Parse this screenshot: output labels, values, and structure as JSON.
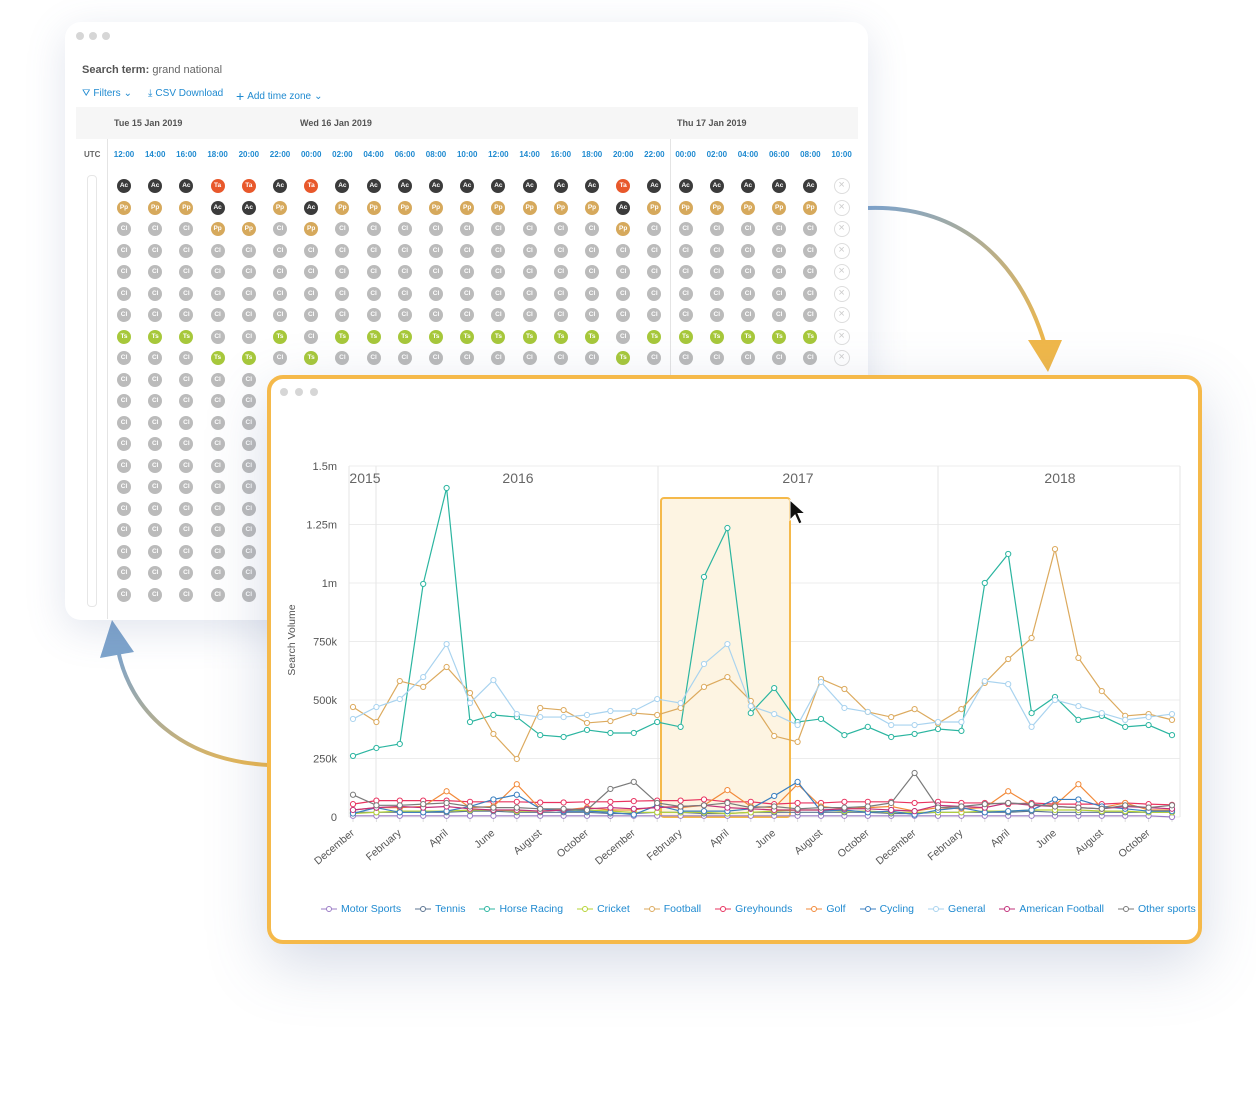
{
  "schedule": {
    "search_term_label": "Search term:",
    "search_term": "grand national",
    "toolbar": {
      "filters": "Filters",
      "csv": "CSV Download",
      "add_tz": "Add time zone"
    },
    "dates": [
      "Tue 15 Jan 2019",
      "Wed 16 Jan 2019",
      "Thu 17 Jan 2019"
    ],
    "timezone": "UTC",
    "times": [
      "12:00",
      "14:00",
      "16:00",
      "18:00",
      "20:00",
      "22:00",
      "00:00",
      "02:00",
      "04:00",
      "06:00",
      "08:00",
      "10:00",
      "12:00",
      "14:00",
      "16:00",
      "18:00",
      "20:00",
      "22:00",
      "00:00",
      "02:00",
      "04:00",
      "06:00",
      "08:00",
      "10:00"
    ],
    "badge_colors": {
      "Ac": "#3b3b3b",
      "Ta": "#e8582b",
      "Pp": "#d6a95c",
      "Cl": "#bbbbbb",
      "Ts": "#a7c83b"
    },
    "rows": [
      [
        "Ac",
        "Ac",
        "Ac",
        "Ta",
        "Ta",
        "Ac",
        "Ta",
        "Ac",
        "Ac",
        "Ac",
        "Ac",
        "Ac",
        "Ac",
        "Ac",
        "Ac",
        "Ac",
        "Ta",
        "Ac",
        "Ac",
        "Ac",
        "Ac",
        "Ac",
        "Ac",
        "X"
      ],
      [
        "Pp",
        "Pp",
        "Pp",
        "Ac",
        "Ac",
        "Pp",
        "Ac",
        "Pp",
        "Pp",
        "Pp",
        "Pp",
        "Pp",
        "Pp",
        "Pp",
        "Pp",
        "Pp",
        "Ac",
        "Pp",
        "Pp",
        "Pp",
        "Pp",
        "Pp",
        "Pp",
        "X"
      ],
      [
        "Cl",
        "Cl",
        "Cl",
        "Pp",
        "Pp",
        "Cl",
        "Pp",
        "Cl",
        "Cl",
        "Cl",
        "Cl",
        "Cl",
        "Cl",
        "Cl",
        "Cl",
        "Cl",
        "Pp",
        "Cl",
        "Cl",
        "Cl",
        "Cl",
        "Cl",
        "Cl",
        "X"
      ],
      [
        "Cl",
        "Cl",
        "Cl",
        "Cl",
        "Cl",
        "Cl",
        "Cl",
        "Cl",
        "Cl",
        "Cl",
        "Cl",
        "Cl",
        "Cl",
        "Cl",
        "Cl",
        "Cl",
        "Cl",
        "Cl",
        "Cl",
        "Cl",
        "Cl",
        "Cl",
        "Cl",
        "X"
      ],
      [
        "Cl",
        "Cl",
        "Cl",
        "Cl",
        "Cl",
        "Cl",
        "Cl",
        "Cl",
        "Cl",
        "Cl",
        "Cl",
        "Cl",
        "Cl",
        "Cl",
        "Cl",
        "Cl",
        "Cl",
        "Cl",
        "Cl",
        "Cl",
        "Cl",
        "Cl",
        "Cl",
        "X"
      ],
      [
        "Cl",
        "Cl",
        "Cl",
        "Cl",
        "Cl",
        "Cl",
        "Cl",
        "Cl",
        "Cl",
        "Cl",
        "Cl",
        "Cl",
        "Cl",
        "Cl",
        "Cl",
        "Cl",
        "Cl",
        "Cl",
        "Cl",
        "Cl",
        "Cl",
        "Cl",
        "Cl",
        "X"
      ],
      [
        "Cl",
        "Cl",
        "Cl",
        "Cl",
        "Cl",
        "Cl",
        "Cl",
        "Cl",
        "Cl",
        "Cl",
        "Cl",
        "Cl",
        "Cl",
        "Cl",
        "Cl",
        "Cl",
        "Cl",
        "Cl",
        "Cl",
        "Cl",
        "Cl",
        "Cl",
        "Cl",
        "X"
      ],
      [
        "Ts",
        "Ts",
        "Ts",
        "Cl",
        "Cl",
        "Ts",
        "Cl",
        "Ts",
        "Ts",
        "Ts",
        "Ts",
        "Ts",
        "Ts",
        "Ts",
        "Ts",
        "Ts",
        "Cl",
        "Ts",
        "Ts",
        "Ts",
        "Ts",
        "Ts",
        "Ts",
        "X"
      ],
      [
        "Cl",
        "Cl",
        "Cl",
        "Ts",
        "Ts",
        "Cl",
        "Ts",
        "Cl",
        "Cl",
        "Cl",
        "Cl",
        "Cl",
        "Cl",
        "Cl",
        "Cl",
        "Cl",
        "Ts",
        "Cl",
        "Cl",
        "Cl",
        "Cl",
        "Cl",
        "Cl",
        "X"
      ],
      [
        "Cl",
        "Cl",
        "Cl",
        "Cl",
        "Cl"
      ],
      [
        "Cl",
        "Cl",
        "Cl",
        "Cl",
        "Cl"
      ],
      [
        "Cl",
        "Cl",
        "Cl",
        "Cl",
        "Cl"
      ],
      [
        "Cl",
        "Cl",
        "Cl",
        "Cl",
        "Cl"
      ],
      [
        "Cl",
        "Cl",
        "Cl",
        "Cl",
        "Cl"
      ],
      [
        "Cl",
        "Cl",
        "Cl",
        "Cl",
        "Cl"
      ],
      [
        "Cl",
        "Cl",
        "Cl",
        "Cl",
        "Cl"
      ],
      [
        "Cl",
        "Cl",
        "Cl",
        "Cl",
        "Cl"
      ],
      [
        "Cl",
        "Cl",
        "Cl",
        "Cl",
        "Cl"
      ],
      [
        "Cl",
        "Cl",
        "Cl",
        "Cl",
        "Cl"
      ],
      [
        "Cl",
        "Cl",
        "Cl",
        "Cl",
        "Cl"
      ]
    ]
  },
  "chart_data": {
    "type": "line",
    "ylabel": "Search Volume",
    "ylim": [
      0,
      1500000
    ],
    "yticks": [
      "0",
      "250k",
      "500k",
      "750k",
      "1m",
      "1.25m",
      "1.5m"
    ],
    "years": [
      "2015",
      "2016",
      "2017",
      "2018"
    ],
    "x": [
      "December",
      "January",
      "February",
      "March",
      "April",
      "May",
      "June",
      "July",
      "August",
      "September",
      "October",
      "November",
      "December",
      "January",
      "February",
      "March",
      "April",
      "May",
      "June",
      "July",
      "August",
      "September",
      "October",
      "November",
      "December",
      "January",
      "February",
      "March",
      "April",
      "May",
      "June",
      "July",
      "August",
      "September",
      "October",
      "November"
    ],
    "xtick_labels": [
      "December",
      "February",
      "April",
      "June",
      "August",
      "October",
      "December",
      "February",
      "April",
      "June",
      "August",
      "October",
      "December",
      "February",
      "April",
      "June",
      "August",
      "October"
    ],
    "highlight_range": [
      "January",
      "June"
    ],
    "grid": true,
    "legend_position": "bottom",
    "series": [
      {
        "name": "Motor Sports",
        "color": "#9b7cc6",
        "values": [
          5,
          5,
          5,
          5,
          5,
          5,
          5,
          5,
          5,
          5,
          5,
          5,
          5,
          5,
          5,
          5,
          5,
          5,
          5,
          5,
          5,
          5,
          5,
          5,
          5,
          5,
          5,
          5,
          5,
          5,
          5,
          5,
          5,
          5,
          5,
          0
        ]
      },
      {
        "name": "Tennis",
        "color": "#5d7592",
        "values": [
          20,
          20,
          20,
          20,
          20,
          25,
          25,
          20,
          20,
          20,
          20,
          15,
          15,
          20,
          20,
          15,
          15,
          20,
          20,
          20,
          20,
          20,
          20,
          15,
          15,
          20,
          20,
          20,
          20,
          25,
          20,
          20,
          20,
          20,
          20,
          20
        ]
      },
      {
        "name": "Horse Racing",
        "color": "#2bb5a0",
        "values": [
          261,
          295,
          312,
          996,
          1406,
          406,
          436,
          427,
          350,
          342,
          372,
          359,
          359,
          406,
          385,
          1026,
          1235,
          444,
          551,
          406,
          419,
          350,
          385,
          342,
          355,
          376,
          368,
          1000,
          1124,
          444,
          513,
          415,
          432,
          385,
          393,
          350
        ]
      },
      {
        "name": "Cricket",
        "color": "#b6d336",
        "values": [
          15,
          20,
          25,
          25,
          25,
          30,
          30,
          25,
          25,
          30,
          30,
          25,
          20,
          20,
          20,
          20,
          15,
          20,
          25,
          30,
          30,
          25,
          25,
          20,
          20,
          20,
          20,
          25,
          25,
          30,
          30,
          30,
          25,
          25,
          20,
          20
        ]
      },
      {
        "name": "Football",
        "color": "#dcaa5e",
        "values": [
          470,
          406,
          581,
          556,
          641,
          530,
          355,
          248,
          466,
          457,
          402,
          410,
          444,
          436,
          466,
          556,
          598,
          496,
          346,
          321,
          590,
          547,
          449,
          427,
          461,
          400,
          461,
          573,
          675,
          765,
          1145,
          680,
          538,
          432,
          440,
          415
        ]
      },
      {
        "name": "Greyhounds",
        "color": "#e8335f",
        "values": [
          55,
          70,
          70,
          70,
          70,
          65,
          65,
          65,
          62,
          62,
          65,
          65,
          68,
          70,
          70,
          75,
          65,
          65,
          55,
          60,
          60,
          65,
          65,
          65,
          60,
          65,
          60,
          60,
          55,
          60,
          55,
          55,
          55,
          60,
          55,
          52
        ]
      },
      {
        "name": "Golf",
        "color": "#f28a3a",
        "values": [
          30,
          40,
          40,
          45,
          110,
          40,
          45,
          140,
          35,
          30,
          40,
          30,
          30,
          45,
          40,
          50,
          115,
          45,
          40,
          140,
          45,
          35,
          40,
          45,
          25,
          40,
          35,
          40,
          110,
          50,
          50,
          140,
          40,
          60,
          30,
          30
        ]
      },
      {
        "name": "Cycling",
        "color": "#3a7fc0",
        "values": [
          15,
          40,
          20,
          20,
          25,
          45,
          75,
          95,
          35,
          25,
          25,
          20,
          10,
          50,
          25,
          25,
          25,
          35,
          90,
          150,
          25,
          30,
          20,
          25,
          10,
          30,
          40,
          20,
          25,
          30,
          75,
          75,
          45,
          35,
          25,
          25
        ]
      },
      {
        "name": "General",
        "color": "#a9d3ef",
        "values": [
          419,
          470,
          504,
          598,
          739,
          487,
          585,
          440,
          427,
          427,
          436,
          453,
          453,
          504,
          487,
          654,
          739,
          474,
          440,
          393,
          577,
          466,
          449,
          393,
          393,
          406,
          406,
          581,
          568,
          385,
          500,
          474,
          444,
          415,
          427,
          440
        ]
      },
      {
        "name": "American Football",
        "color": "#c2307a",
        "values": [
          30,
          40,
          45,
          40,
          45,
          35,
          30,
          30,
          25,
          30,
          35,
          40,
          35,
          40,
          45,
          50,
          40,
          35,
          30,
          30,
          30,
          35,
          35,
          30,
          25,
          50,
          45,
          40,
          60,
          50,
          45,
          40,
          35,
          45,
          40,
          35
        ]
      },
      {
        "name": "Other sports",
        "color": "#7a7a7a",
        "values": [
          95,
          50,
          50,
          55,
          60,
          45,
          40,
          40,
          35,
          35,
          30,
          120,
          150,
          60,
          45,
          50,
          60,
          40,
          45,
          35,
          40,
          40,
          45,
          60,
          188,
          40,
          45,
          55,
          60,
          55,
          45,
          40,
          35,
          50,
          40,
          50
        ]
      }
    ],
    "value_unit_note": "values in thousands"
  }
}
